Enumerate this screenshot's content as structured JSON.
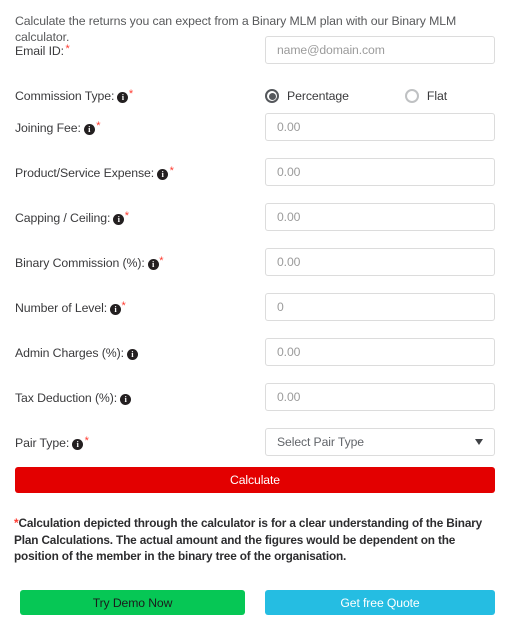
{
  "intro": "Calculate the returns you can expect from a Binary MLM plan with our Binary MLM calculator.",
  "form": {
    "email": {
      "label": "Email ID:",
      "has_info": false,
      "required": true,
      "placeholder": "name@domain.com"
    },
    "commission_type": {
      "label": "Commission Type:",
      "has_info": true,
      "required": true,
      "options": [
        {
          "label": "Percentage",
          "selected": true
        },
        {
          "label": "Flat",
          "selected": false
        }
      ]
    },
    "joining_fee": {
      "label": "Joining Fee:",
      "has_info": true,
      "required": true,
      "placeholder": "0.00"
    },
    "product_service_expense": {
      "label": "Product/Service Expense:",
      "has_info": true,
      "required": true,
      "placeholder": "0.00"
    },
    "capping_ceiling": {
      "label": "Capping / Ceiling:",
      "has_info": true,
      "required": true,
      "placeholder": "0.00"
    },
    "binary_commission": {
      "label": "Binary Commission (%):",
      "has_info": true,
      "required": true,
      "placeholder": "0.00"
    },
    "number_of_level": {
      "label": "Number of Level:",
      "has_info": true,
      "required": true,
      "placeholder": "0"
    },
    "admin_charges": {
      "label": "Admin Charges (%):",
      "has_info": true,
      "required": false,
      "placeholder": "0.00"
    },
    "tax_deduction": {
      "label": "Tax Deduction (%):",
      "has_info": true,
      "required": false,
      "placeholder": "0.00"
    },
    "pair_type": {
      "label": "Pair Type:",
      "has_info": true,
      "required": true,
      "selected_value": "Select Pair Type"
    }
  },
  "actions": {
    "calculate_label": "Calculate",
    "try_demo_label": "Try Demo Now",
    "get_quote_label": "Get free Quote"
  },
  "disclaimer": {
    "asterisk": "*",
    "text": "Calculation depicted through the calculator is for a clear understanding of the Binary Plan Calculations. The actual amount and the figures would be dependent on the position of the member in the binary tree of the organisation."
  },
  "icons": {
    "info": "i",
    "required_marker": "*",
    "dropdown": "chevron-down-icon"
  },
  "colors": {
    "calculate": "#e30000",
    "demo": "#06c755",
    "quote": "#25bde2",
    "required": "#ff3b30"
  }
}
